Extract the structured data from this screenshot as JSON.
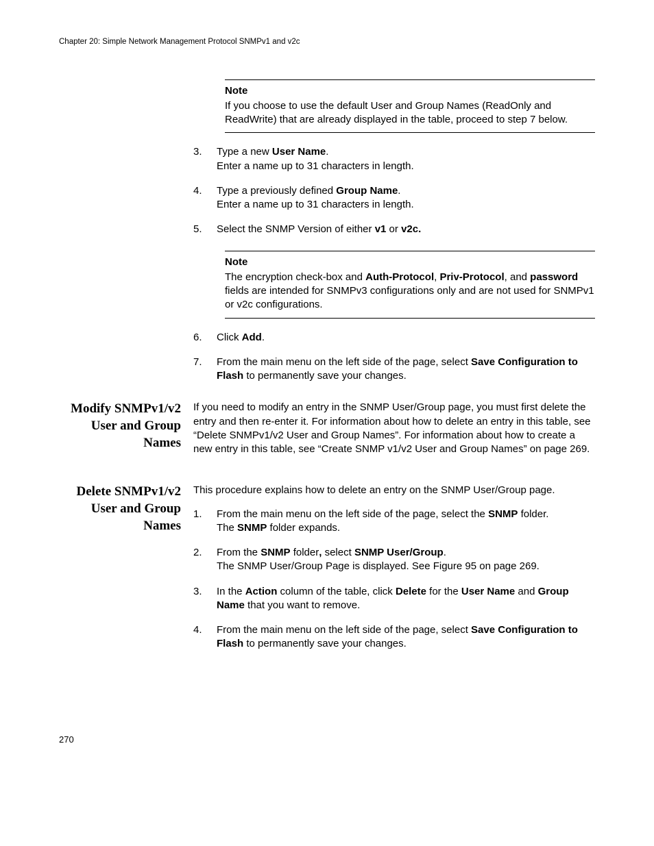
{
  "runningHead": "Chapter 20: Simple Network Management Protocol SNMPv1 and v2c",
  "note1": {
    "head": "Note",
    "body": "If you choose to use the default User and Group Names (ReadOnly and ReadWrite) that are already displayed in the table, proceed to step 7 below."
  },
  "steps1": {
    "s3": {
      "num": "3.",
      "a": "Type a new ",
      "b": "User Name",
      "c": ".",
      "d": "Enter a name up to 31 characters in length."
    },
    "s4": {
      "num": "4.",
      "a": "Type a previously defined ",
      "b": "Group Name",
      "c": ".",
      "d": "Enter a name up to 31 characters in length."
    },
    "s5": {
      "num": "5.",
      "a": "Select the SNMP Version of either ",
      "b": "v1",
      "c": " or ",
      "d": "v2c."
    }
  },
  "note2": {
    "head": "Note",
    "a": "The encryption check-box and ",
    "b": "Auth-Protocol",
    "c": ", ",
    "d": "Priv-Protocol",
    "e": ", and ",
    "f": "password",
    "g": " fields are intended for SNMPv3 configurations only and are not used for SNMPv1 or v2c configurations."
  },
  "steps2": {
    "s6": {
      "num": "6.",
      "a": "Click ",
      "b": "Add",
      "c": "."
    },
    "s7": {
      "num": "7.",
      "a": "From the main menu on the left side of the page, select ",
      "b": "Save Configuration to Flash",
      "c": " to permanently save your changes."
    }
  },
  "modify": {
    "head": "Modify SNMPv1/v2 User and Group Names",
    "body": "If you need to modify an entry in the SNMP User/Group page, you must first delete the entry and then re-enter it. For information about how to delete an entry in this table, see “Delete SNMPv1/v2 User and Group Names”. For information about how to create a new entry in this table, see “Create SNMP v1/v2 User and Group Names” on page 269."
  },
  "delete": {
    "head": "Delete SNMPv1/v2 User and Group Names",
    "intro": "This procedure explains how to delete an entry on the SNMP User/Group page.",
    "s1": {
      "num": "1.",
      "a": "From the main menu on the left side of the page, select the ",
      "b": "SNMP",
      "c": " folder.",
      "d": "The ",
      "e": "SNMP",
      "f": " folder expands."
    },
    "s2": {
      "num": "2.",
      "a": "From the ",
      "b": "SNMP",
      "c": " folder",
      "comma": ",",
      "d": " select ",
      "e": "SNMP User/Group",
      "f": ".",
      "g": "The SNMP User/Group Page is displayed. See Figure 95 on page 269."
    },
    "s3": {
      "num": "3.",
      "a": "In the ",
      "b": "Action",
      "c": " column of the table, click ",
      "d": "Delete",
      "e": " for the ",
      "f": "User Name",
      "g": " and ",
      "h": "Group Name",
      "i": " that you want to remove."
    },
    "s4": {
      "num": "4.",
      "a": "From the main menu on the left side of the page, select ",
      "b": "Save Configuration to Flash",
      "c": " to permanently save your changes."
    }
  },
  "pageNum": "270"
}
